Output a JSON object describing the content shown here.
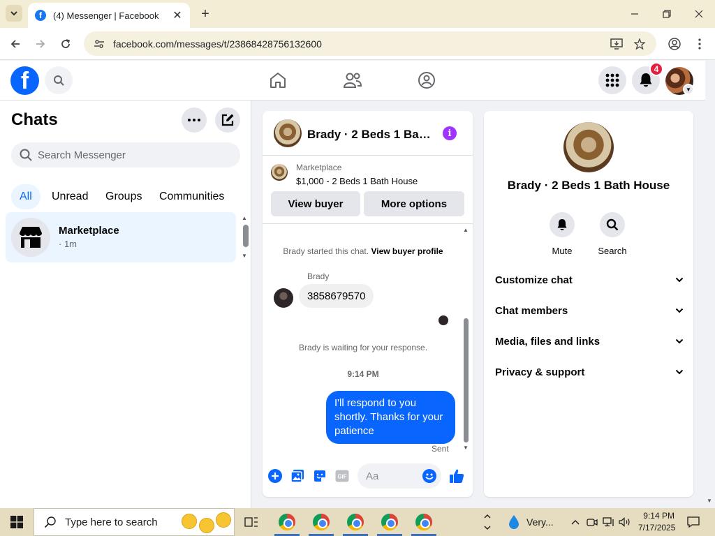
{
  "browser": {
    "tab_title": "(4) Messenger | Facebook",
    "favicon_letter": "f",
    "url": "facebook.com/messages/t/23868428756132600"
  },
  "header": {
    "notification_count": "4",
    "logo_letter": "f"
  },
  "chats": {
    "title": "Chats",
    "search_placeholder": "Search Messenger",
    "filters": [
      "All",
      "Unread",
      "Groups",
      "Communities"
    ],
    "active_filter": "All",
    "items": [
      {
        "name": "Marketplace",
        "time": "· 1m"
      }
    ]
  },
  "conversation": {
    "title": "Brady · 2 Beds 1 Bath House",
    "listing_label": "Marketplace",
    "listing_price": "$1,000 - 2 Beds 1 Bath House",
    "view_buyer_label": "View buyer",
    "more_options_label": "More options",
    "started_text": "Brady started this chat.",
    "view_profile_link": "View buyer profile",
    "sender_name": "Brady",
    "incoming_message": "3858679570",
    "waiting_text": "Brady is waiting for your response.",
    "timestamp": "9:14 PM",
    "outgoing_message": "I'll respond to you shortly. Thanks for your patience",
    "status": "Sent",
    "composer_placeholder": "Aa",
    "gif_label": "GIF"
  },
  "info_panel": {
    "name": "Brady · 2 Beds 1 Bath House",
    "actions": [
      {
        "label": "Mute",
        "icon": "bell-icon"
      },
      {
        "label": "Search",
        "icon": "search-icon"
      }
    ],
    "sections": [
      "Customize chat",
      "Chat members",
      "Media, files and links",
      "Privacy & support"
    ]
  },
  "taskbar": {
    "search_placeholder": "Type here to search",
    "weather": "Very...",
    "time": "9:14 PM",
    "date": "7/17/2025"
  },
  "colors": {
    "accent": "#0866ff",
    "badge": "#e41e3f",
    "info": "#a033ff"
  }
}
